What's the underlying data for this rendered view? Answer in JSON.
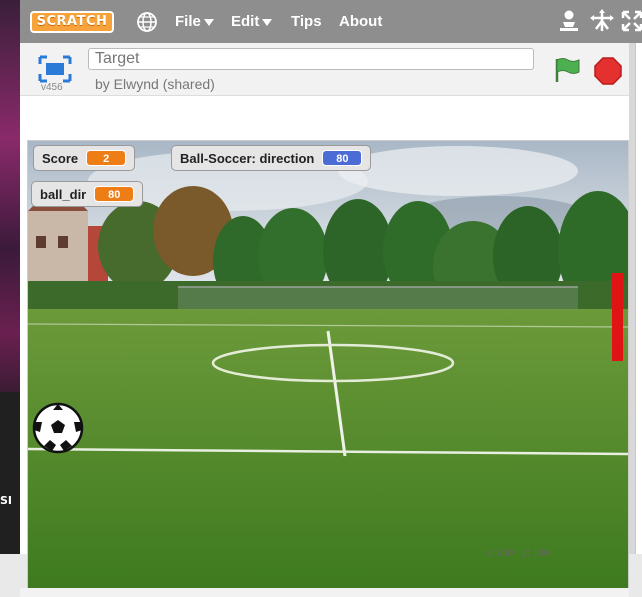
{
  "menubar": {
    "logo": "SCRATCH",
    "items": [
      {
        "label": "File",
        "has_caret": true
      },
      {
        "label": "Edit",
        "has_caret": true
      },
      {
        "label": "Tips",
        "has_caret": false
      },
      {
        "label": "About",
        "has_caret": false
      }
    ],
    "icons": [
      "globe-icon",
      "user-icon",
      "grow-icon",
      "fullscreen-icon"
    ]
  },
  "player": {
    "version": "v456",
    "title": "Target",
    "byline": "by Elwynd (shared)",
    "icons": [
      "present-icon",
      "green-flag-icon",
      "stop-icon"
    ]
  },
  "monitors": [
    {
      "label": "Score",
      "value": "2",
      "color": "#ee7d16"
    },
    {
      "label": "Ball-Soccer: direction",
      "value": "80",
      "color": "#4a6cd4"
    },
    {
      "label": "ball_dir",
      "value": "80",
      "color": "#ee7d16"
    }
  ],
  "stage": {
    "sprites": [
      "soccer-ball-sprite",
      "red-target-sprite"
    ],
    "coords": {
      "x_label": "x:",
      "x_value": "240",
      "y_label": "y:",
      "y_value": "180"
    }
  },
  "left_strip": {
    "text": "SI"
  },
  "colors": {
    "menubar": "#8e8e8e",
    "logo": "#f7a23a",
    "flag": "#4caf50",
    "stop": "#e03030",
    "target": "#e01414"
  }
}
